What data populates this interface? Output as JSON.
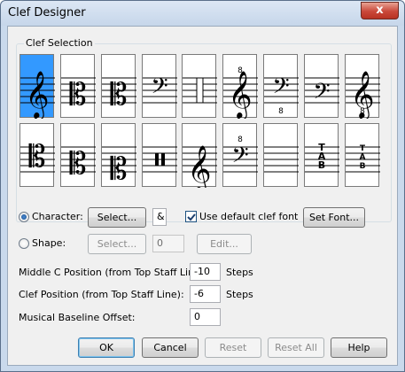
{
  "window": {
    "title": "Clef Designer",
    "close_glyph": "x"
  },
  "group": {
    "label": "Clef Selection"
  },
  "clef_tiles": [
    {
      "icon": "treble-clef-icon",
      "glyph": "𝄞",
      "selected": true
    },
    {
      "icon": "alto-clef-icon",
      "glyph": "𝄡",
      "selected": false
    },
    {
      "icon": "tenor-clef-icon",
      "glyph": "𝄡",
      "selected": false
    },
    {
      "icon": "bass-clef-icon",
      "glyph": "𝄢",
      "selected": false
    },
    {
      "icon": "percussion-clef-icon",
      "glyph": "",
      "selected": false
    },
    {
      "icon": "treble-8va-clef-icon",
      "glyph": "𝄞",
      "selected": false
    },
    {
      "icon": "bass-8vb-clef-icon",
      "glyph": "𝄢",
      "selected": false
    },
    {
      "icon": "bass-clef-low-icon",
      "glyph": "𝄢",
      "selected": false
    },
    {
      "icon": "treble-8vb-clef-icon",
      "glyph": "𝄞",
      "selected": false
    },
    {
      "icon": "c-clef-top-icon",
      "glyph": "𝄡",
      "selected": false
    },
    {
      "icon": "c-clef-mid-icon",
      "glyph": "𝄡",
      "selected": false
    },
    {
      "icon": "c-clef-low-icon",
      "glyph": "𝄡",
      "selected": false
    },
    {
      "icon": "percussion-bars-icon",
      "glyph": "",
      "selected": false
    },
    {
      "icon": "treble-clef-low-icon",
      "glyph": "𝄞",
      "selected": false
    },
    {
      "icon": "bass-8va-clef-icon",
      "glyph": "𝄢",
      "selected": false
    },
    {
      "icon": "blank-staff-icon",
      "glyph": "",
      "selected": false
    },
    {
      "icon": "tab-clef-icon",
      "glyph": "TAB",
      "selected": false
    },
    {
      "icon": "tab-clef-small-icon",
      "glyph": "TAB",
      "selected": false
    }
  ],
  "character": {
    "label": "Character:",
    "select_button": "Select...",
    "value": "&",
    "use_default_font_label": "Use default clef font",
    "use_default_font_checked": true,
    "set_font_button": "Set Font..."
  },
  "shape": {
    "label": "Shape:",
    "select_button": "Select...",
    "value": "0",
    "edit_button": "Edit..."
  },
  "middle_c": {
    "label": "Middle C Position (from Top Staff Line):",
    "value": "-10",
    "unit": "Steps"
  },
  "clef_position": {
    "label": "Clef Position (from Top Staff Line):",
    "value": "-6",
    "unit": "Steps"
  },
  "baseline": {
    "label": "Musical Baseline Offset:",
    "value": "0"
  },
  "buttons": {
    "ok": "OK",
    "cancel": "Cancel",
    "reset": "Reset",
    "reset_all": "Reset All",
    "help": "Help"
  },
  "colors": {
    "selected_tile": "#3399ff",
    "title_bar": "#c9d9ec",
    "close_button": "#c9483a"
  }
}
